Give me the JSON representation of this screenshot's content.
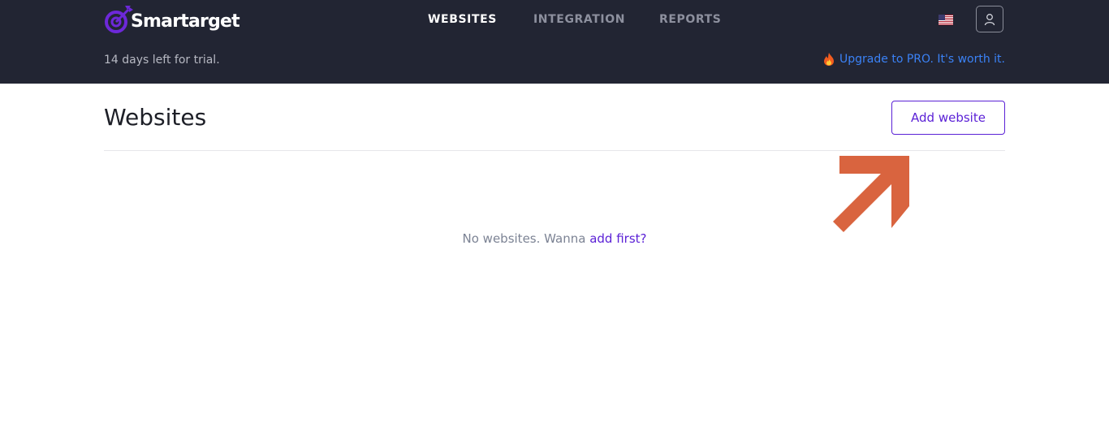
{
  "app": {
    "brand": "Smartarget",
    "brand_color": "#6d28d9"
  },
  "nav": {
    "items": [
      {
        "label": "WEBSITES",
        "active": true
      },
      {
        "label": "INTEGRATION",
        "active": false
      },
      {
        "label": "REPORTS",
        "active": false
      }
    ]
  },
  "header": {
    "language_icon": "us-flag-icon",
    "user_icon": "user-icon",
    "trial_text": "14 days left for trial.",
    "upgrade_text": "Upgrade to PRO. It's worth it.",
    "upgrade_icon": "fire-icon",
    "upgrade_color": "#3b82f6"
  },
  "main": {
    "title": "Websites",
    "add_button_label": "Add website",
    "empty_text": "No websites. Wanna",
    "empty_link": "add first?",
    "accent_color": "#5b21d6",
    "annotation_arrow_color": "#d9643f"
  }
}
